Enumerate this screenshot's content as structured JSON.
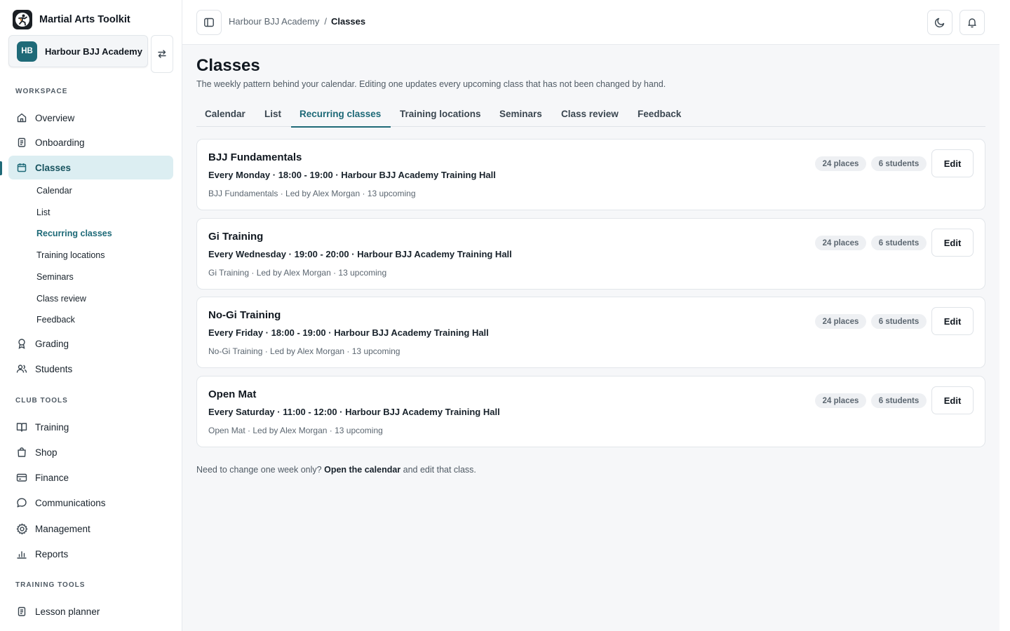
{
  "app": {
    "name": "Martial Arts Toolkit"
  },
  "workspace": {
    "initials": "HB",
    "name": "Harbour BJJ Academy"
  },
  "sidebar": {
    "sections": {
      "workspace": "WORKSPACE",
      "club_tools": "CLUB TOOLS",
      "training_tools": "TRAINING TOOLS"
    },
    "items": {
      "overview": "Overview",
      "onboarding": "Onboarding",
      "classes": "Classes",
      "grading": "Grading",
      "students": "Students",
      "training": "Training",
      "shop": "Shop",
      "finance": "Finance",
      "communications": "Communications",
      "management": "Management",
      "reports": "Reports",
      "lesson_planner": "Lesson planner"
    },
    "class_subitems": {
      "calendar": "Calendar",
      "list": "List",
      "recurring": "Recurring classes",
      "locations": "Training locations",
      "seminars": "Seminars",
      "review": "Class review",
      "feedback": "Feedback"
    }
  },
  "breadcrumb": {
    "parent": "Harbour BJJ Academy",
    "separator": "/",
    "current": "Classes"
  },
  "page": {
    "title": "Classes",
    "description": "The weekly pattern behind your calendar. Editing one updates every upcoming class that has not been changed by hand."
  },
  "tabs": {
    "calendar": "Calendar",
    "list": "List",
    "recurring": "Recurring classes",
    "locations": "Training locations",
    "seminars": "Seminars",
    "review": "Class review",
    "feedback": "Feedback"
  },
  "classes": [
    {
      "title": "BJJ Fundamentals",
      "schedule": "Every Monday · 18:00 - 19:00 · Harbour BJJ Academy Training Hall",
      "meta": "BJJ Fundamentals · Led by Alex Morgan · 13 upcoming",
      "places": "24 places",
      "students": "6 students",
      "edit_label": "Edit"
    },
    {
      "title": "Gi Training",
      "schedule": "Every Wednesday · 19:00 - 20:00 · Harbour BJJ Academy Training Hall",
      "meta": "Gi Training · Led by Alex Morgan · 13 upcoming",
      "places": "24 places",
      "students": "6 students",
      "edit_label": "Edit"
    },
    {
      "title": "No-Gi Training",
      "schedule": "Every Friday · 18:00 - 19:00 · Harbour BJJ Academy Training Hall",
      "meta": "No-Gi Training · Led by Alex Morgan · 13 upcoming",
      "places": "24 places",
      "students": "6 students",
      "edit_label": "Edit"
    },
    {
      "title": "Open Mat",
      "schedule": "Every Saturday · 11:00 - 12:00 · Harbour BJJ Academy Training Hall",
      "meta": "Open Mat · Led by Alex Morgan · 13 upcoming",
      "places": "24 places",
      "students": "6 students",
      "edit_label": "Edit"
    }
  ],
  "footer": {
    "prefix": "Need to change one week only?",
    "link": "Open the calendar",
    "suffix": "and edit that class."
  },
  "colors": {
    "accent": "#1f6a78",
    "active_nav_bg": "#dceef2",
    "main_bg": "#f6f7f9"
  }
}
